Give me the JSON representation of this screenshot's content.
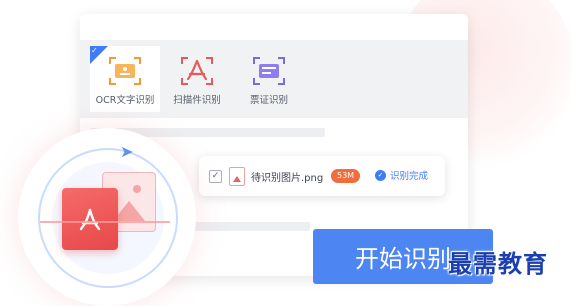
{
  "toolbar": {
    "tools": [
      {
        "label": "OCR文字识别",
        "icon": "ocr-text-icon",
        "active": true
      },
      {
        "label": "扫描件识别",
        "icon": "pdf-scan-icon",
        "active": false
      },
      {
        "label": "票证识别",
        "icon": "ticket-id-icon",
        "active": false
      }
    ],
    "active_check": "✓"
  },
  "file": {
    "checkbox": "✓",
    "name": "待识别图片.png",
    "size": "53M",
    "status": "识别完成",
    "status_icon": "✓"
  },
  "start_button": "开始识别",
  "watermark": "最需教育",
  "colors": {
    "accent": "#4d86f2",
    "badge": "#f26d3d",
    "pdf": "#e84848"
  }
}
